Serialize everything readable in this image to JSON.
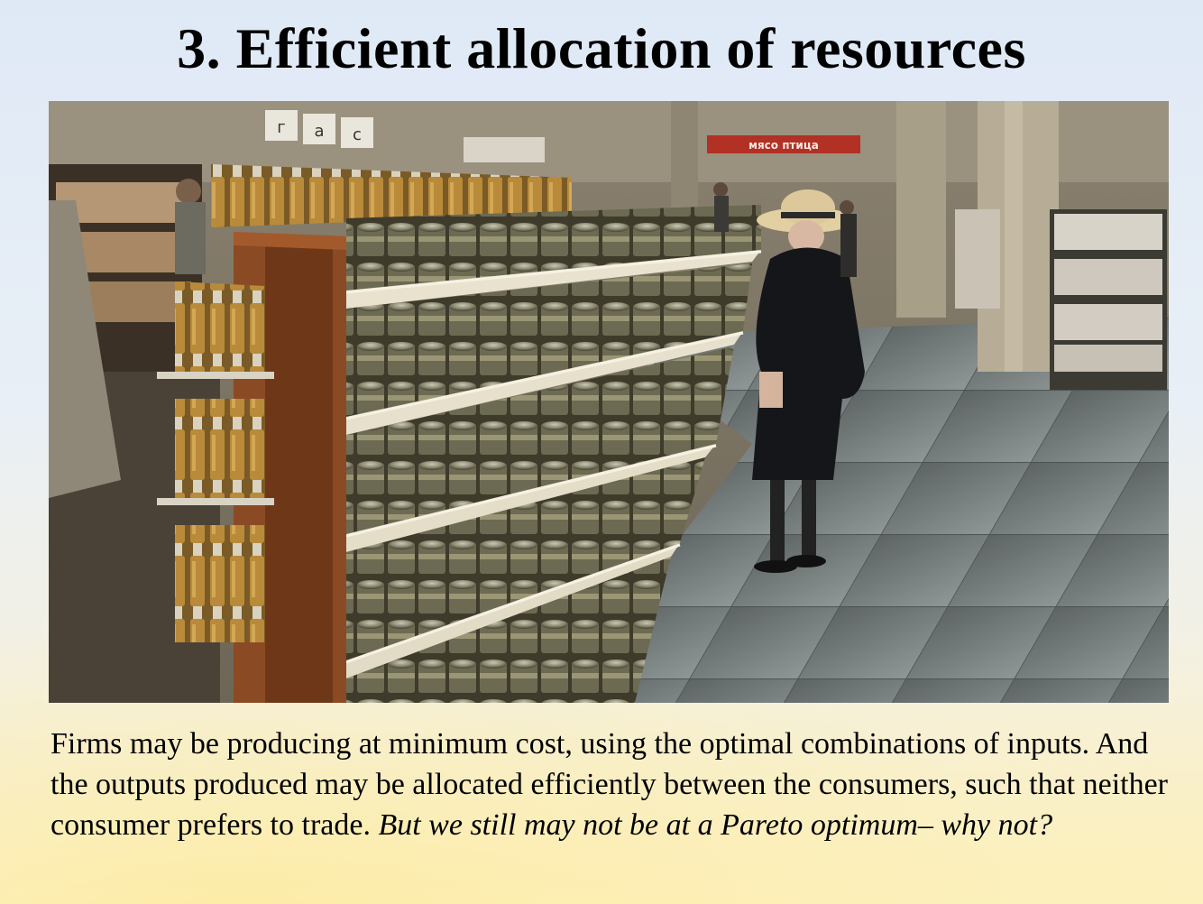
{
  "slide": {
    "title": "3. Efficient allocation of resources",
    "body_normal": "Firms may be producing at minimum cost, using the optimal combinations of inputs.  And the outputs produced may be allocated efficiently between the consumers, such that neither consumer prefers to trade.   ",
    "body_italic": "But we still may not be at a Pareto optimum– why not?"
  },
  "photo": {
    "sign_letters": [
      "г",
      "а",
      "с"
    ],
    "store_sign": "мясо птица"
  }
}
